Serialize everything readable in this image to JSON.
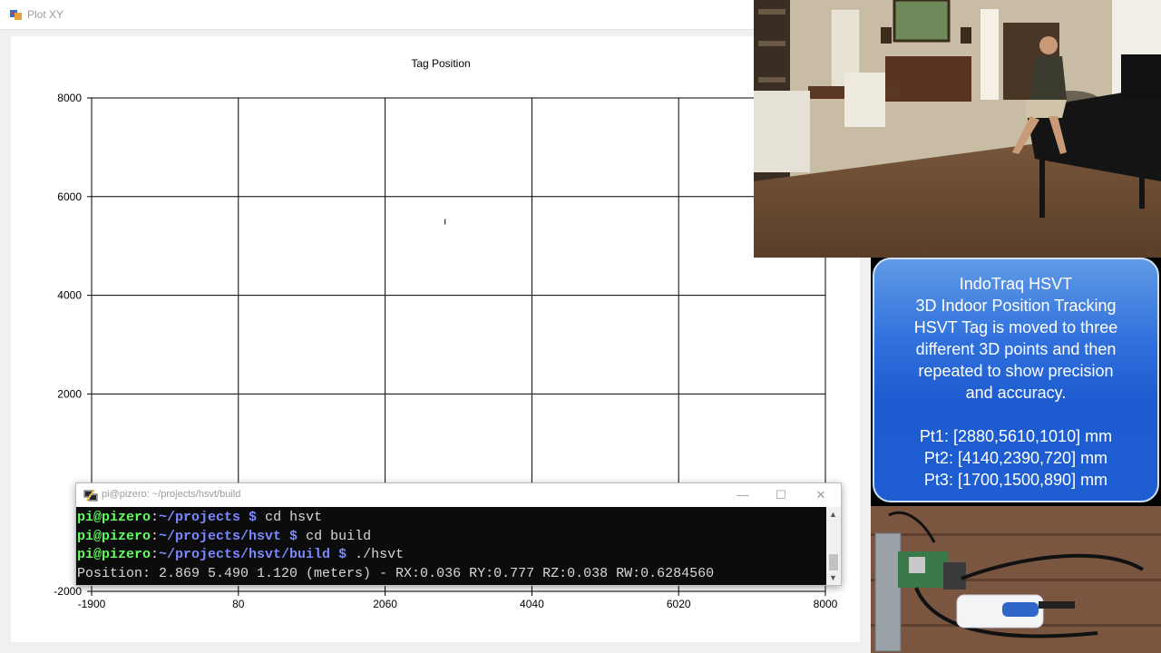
{
  "window": {
    "title": "Plot XY"
  },
  "chart_data": {
    "type": "scatter",
    "title": "Tag Position",
    "xlabel": "",
    "ylabel": "",
    "xlim": [
      -1900,
      8000
    ],
    "ylim": [
      -2000,
      8000
    ],
    "x_ticks": [
      "-1900",
      "80",
      "2060",
      "4040",
      "6020",
      "8000"
    ],
    "y_ticks": [
      "-2000",
      "2000",
      "4000",
      "6000",
      "8000"
    ],
    "x_tick_values": [
      -1900,
      80,
      2060,
      4040,
      6020,
      8000
    ],
    "y_tick_values": [
      -2000,
      2000,
      4000,
      6000,
      8000
    ],
    "grid": true,
    "points": [
      {
        "x": 2869,
        "y": 5490
      }
    ]
  },
  "terminal": {
    "title": "pi@pizero: ~/projects/hsvt/build",
    "controls": {
      "minimize": "—",
      "maximize": "☐",
      "close": "✕"
    },
    "lines": [
      {
        "user": "pi@pizero",
        "path": "~/projects $",
        "cmd": " cd hsvt"
      },
      {
        "user": "pi@pizero",
        "path": "~/projects/hsvt $",
        "cmd": " cd build"
      },
      {
        "user": "pi@pizero",
        "path": "~/projects/hsvt/build $",
        "cmd": " ./hsvt"
      }
    ],
    "output": "Position: 2.869 5.490 1.120 (meters) - RX:0.036 RY:0.777 RZ:0.038 RW:0.6284560"
  },
  "info": {
    "lines": [
      "IndoTraq HSVT",
      "3D Indoor Position Tracking",
      "HSVT Tag is moved to three",
      "different 3D points and then",
      "repeated to show precision",
      "and accuracy.",
      "",
      "Pt1: [2880,5610,1010] mm",
      "Pt2: [4140,2390,720] mm",
      "Pt3: [1700,1500,890] mm"
    ]
  },
  "colors": {
    "terminal_user": "#5fff5f",
    "terminal_path": "#7a88ff",
    "info_box": "#1f5ed2"
  },
  "icons": {
    "plot_app": "chart-window-icon",
    "terminal_app": "putty-icon"
  }
}
